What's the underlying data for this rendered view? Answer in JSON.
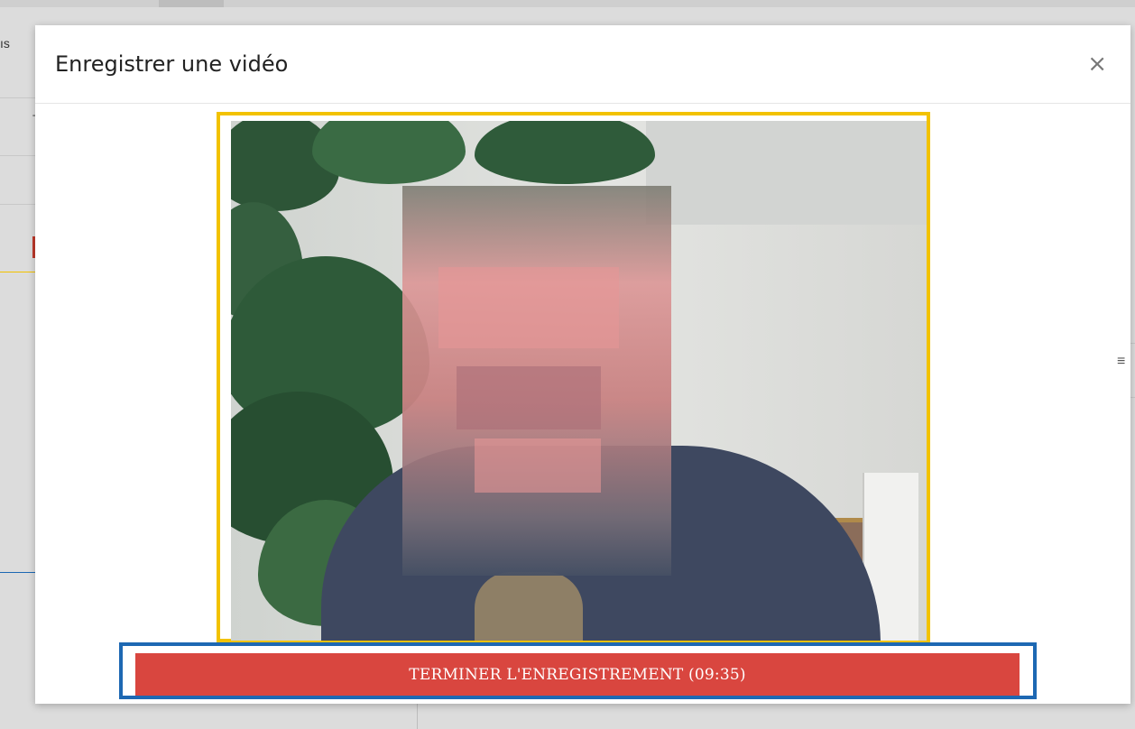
{
  "background": {
    "left_fragment": "ıs",
    "left_t": "T",
    "right_icon": "menu-lines-icon"
  },
  "modal": {
    "title": "Enregistrer une vidéo",
    "close_label": "×"
  },
  "video_preview": {
    "state": "recording"
  },
  "record_button": {
    "label": "TERMINER L'ENREGISTREMENT (09:35)",
    "color": "#d9463f"
  },
  "highlights": {
    "video_outline_color": "#f2c200",
    "button_outline_color": "#1d68b3"
  }
}
